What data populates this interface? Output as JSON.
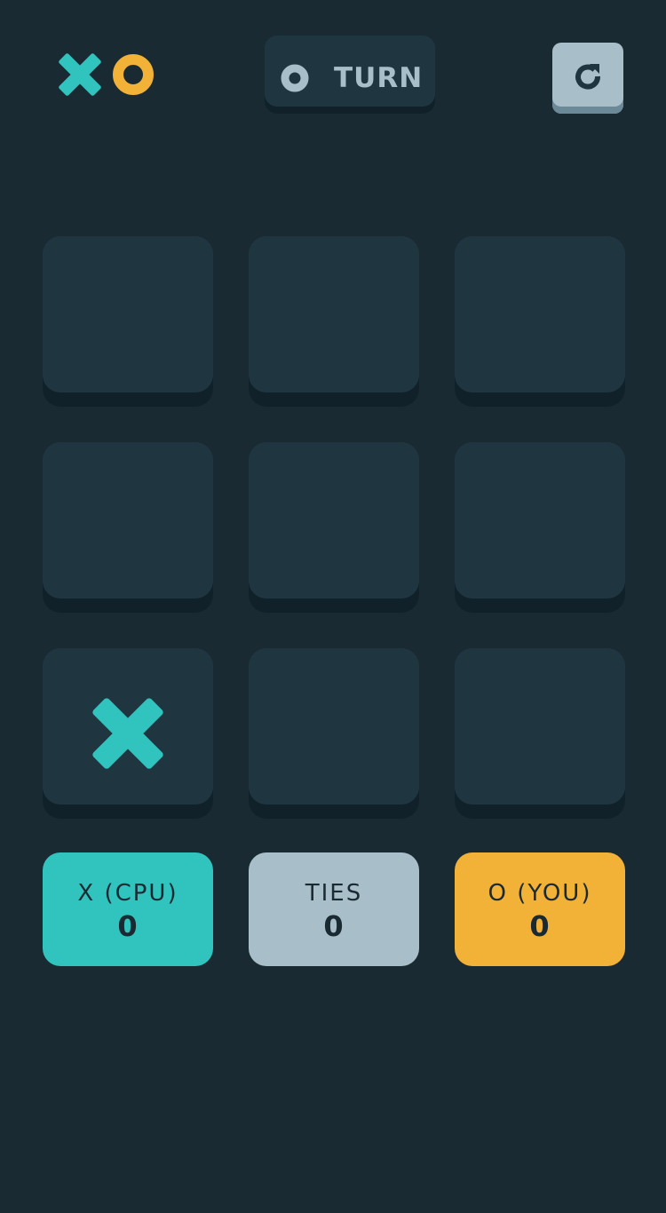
{
  "colors": {
    "background": "#1a2a33",
    "cell": "#1f3641",
    "cell_shadow": "#10212a",
    "x_color": "#31c3bd",
    "o_color": "#f2b137",
    "silver": "#a8bfc9"
  },
  "logo": {
    "icons": [
      "x-icon",
      "o-icon"
    ]
  },
  "turn_indicator": {
    "icon": "o-icon",
    "label": "TURN"
  },
  "restart_button": {
    "icon": "restart-icon"
  },
  "board": {
    "cells": [
      {
        "mark": ""
      },
      {
        "mark": ""
      },
      {
        "mark": ""
      },
      {
        "mark": ""
      },
      {
        "mark": ""
      },
      {
        "mark": ""
      },
      {
        "mark": "X"
      },
      {
        "mark": ""
      },
      {
        "mark": ""
      }
    ]
  },
  "scores": {
    "x": {
      "label": "X (CPU)",
      "value": "0",
      "color": "#31c3bd"
    },
    "ties": {
      "label": "TIES",
      "value": "0",
      "color": "#a8bfc9"
    },
    "o": {
      "label": "O (YOU)",
      "value": "0",
      "color": "#f2b137"
    }
  }
}
